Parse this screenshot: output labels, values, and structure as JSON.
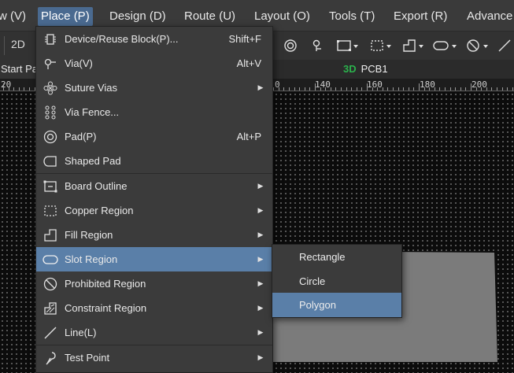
{
  "menubar": {
    "items": [
      "w (V)",
      "Place (P)",
      "Design (D)",
      "Route (U)",
      "Layout (O)",
      "Tools (T)",
      "Export (R)",
      "Advance"
    ],
    "active_index": 1
  },
  "toolbar": {
    "view_2d_label": "2D",
    "icons": [
      "circle-ring-icon",
      "via-icon",
      "board-outline-icon",
      "copper-region-icon",
      "fill-region-icon",
      "slot-region-icon",
      "prohibited-icon",
      "line-icon"
    ]
  },
  "tabs": {
    "start_label": "Start Pa",
    "badge_3d": "3D",
    "pcb_label": "PCB1"
  },
  "ruler": {
    "numbers": [
      "20",
      "0",
      "140",
      "160",
      "180",
      "200"
    ]
  },
  "place_menu": {
    "items": [
      {
        "label": "Device/Reuse Block(P)...",
        "shortcut": "Shift+F",
        "submenu": false,
        "icon": "device-block-icon"
      },
      {
        "label": "Via(V)",
        "shortcut": "Alt+V",
        "submenu": false,
        "icon": "via-icon"
      },
      {
        "label": "Suture Vias",
        "shortcut": "",
        "submenu": true,
        "icon": "suture-vias-icon"
      },
      {
        "label": "Via Fence...",
        "shortcut": "",
        "submenu": false,
        "icon": "via-fence-icon"
      },
      {
        "label": "Pad(P)",
        "shortcut": "Alt+P",
        "submenu": false,
        "icon": "pad-icon"
      },
      {
        "label": "Shaped Pad",
        "shortcut": "",
        "submenu": false,
        "icon": "shaped-pad-icon"
      },
      {
        "label": "Board Outline",
        "shortcut": "",
        "submenu": true,
        "icon": "board-outline-icon"
      },
      {
        "label": "Copper Region",
        "shortcut": "",
        "submenu": true,
        "icon": "copper-region-icon"
      },
      {
        "label": "Fill Region",
        "shortcut": "",
        "submenu": true,
        "icon": "fill-region-icon"
      },
      {
        "label": "Slot Region",
        "shortcut": "",
        "submenu": true,
        "icon": "slot-region-icon"
      },
      {
        "label": "Prohibited Region",
        "shortcut": "",
        "submenu": true,
        "icon": "prohibited-region-icon"
      },
      {
        "label": "Constraint Region",
        "shortcut": "",
        "submenu": true,
        "icon": "constraint-region-icon"
      },
      {
        "label": "Line(L)",
        "shortcut": "",
        "submenu": true,
        "icon": "line-icon"
      },
      {
        "label": "Test Point",
        "shortcut": "",
        "submenu": true,
        "icon": "test-point-icon"
      }
    ],
    "highlighted_index": 9
  },
  "slot_submenu": {
    "items": [
      "Rectangle",
      "Circle",
      "Polygon"
    ],
    "highlighted_index": 2
  },
  "colors": {
    "menu_bg": "#3b3b3b",
    "highlight": "#5a7fa8",
    "active_menu": "#4a6a90",
    "canvas_bg": "#0c0c0c",
    "board_fill": "#7b7b7b",
    "badge_3d": "#2bb24c"
  }
}
